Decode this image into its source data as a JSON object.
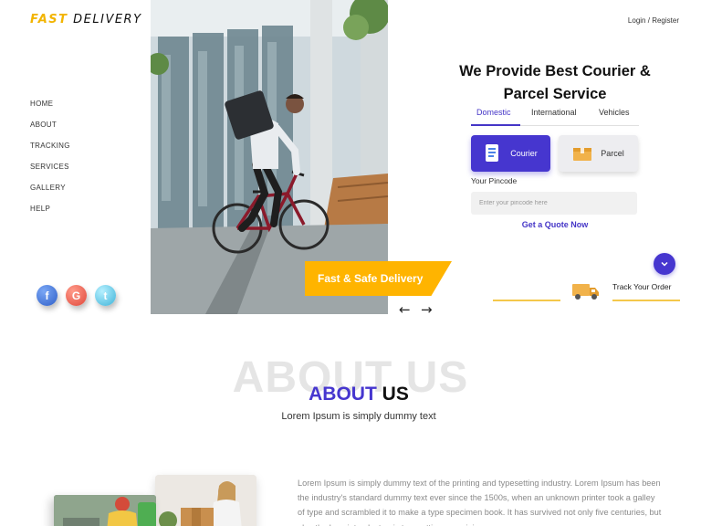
{
  "brand": {
    "part1": "FAST",
    "part2": "DELIVERY"
  },
  "header": {
    "login": "Login",
    "separator": "/",
    "register": "Register"
  },
  "nav": {
    "items": [
      "HOME",
      "ABOUT",
      "TRACKING",
      "SERVICES",
      "GALLERY",
      "HELP"
    ]
  },
  "social": {
    "facebook": "f",
    "google": "G",
    "twitter": "t"
  },
  "hero": {
    "banner": "Fast & Safe Delivery",
    "prev_arrow": "←",
    "next_arrow": "→",
    "image_icon": "cyclist-courier-photo"
  },
  "booking": {
    "headline_line1": "We Provide Best Courier &",
    "headline_line2": "Parcel Service",
    "tabs": [
      "Domestic",
      "International",
      "Vehicles"
    ],
    "active_tab": "Domestic",
    "services": {
      "courier": "Courier",
      "parcel": "Parcel"
    },
    "pincode_label": "Your Pincode",
    "pincode_placeholder": "Enter your pincode here",
    "pincode_value": "",
    "quote_link": "Get a Quote Now",
    "track_order": "Track Your Order",
    "down_icon": "chevron-down-icon"
  },
  "about": {
    "bg_title": "ABOUT US",
    "title_part1": "ABOUT",
    "title_part2": "US",
    "subtitle": "Lorem Ipsum is simply dummy text",
    "body": "Lorem Ipsum is simply dummy text of the printing and typesetting industry. Lorem Ipsum has been the industry's standard dummy text ever since the 1500s, when an unknown printer took a galley of type and scrambled it to make a type specimen book. It has survived not only five centuries, but also the leap into electronic typesetting, remaining"
  },
  "colors": {
    "accent": "#4636cf",
    "yellow": "#ffb400",
    "line": "#f4c84b"
  }
}
